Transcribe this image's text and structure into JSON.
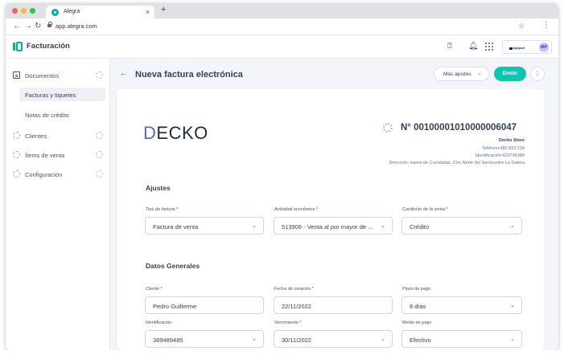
{
  "browser": {
    "tab_title": "Alegra",
    "tab_close": "×",
    "new_tab": "+",
    "url": "app.alegra.com",
    "dot_colors": [
      "#ff5f57",
      "#febc2e",
      "#28c840"
    ]
  },
  "header": {
    "app_title": "Facturación",
    "company_logo": "topsport",
    "avatar": "MP"
  },
  "sidebar": {
    "documentos": "Documentos",
    "facturas": "Facturas y tiquetes",
    "notas": "Notas de crédito",
    "clientes": "Clientes",
    "items": "Ítems de venta",
    "configuracion": "Configuración"
  },
  "page": {
    "title": "Nueva factura electrónica",
    "mas_ajustes": "Más ajustes",
    "emitir": "Emitir"
  },
  "invoice": {
    "brand_initial": "D",
    "brand_rest": "ECKO",
    "number": "N° 00100001010000006047",
    "company_name": "Decko Store",
    "telefono": "Teléfono:980 833 234",
    "identificacion": "Identificación:429745384",
    "direccion": "Dirección: inares de Curridabat, 21m Norte del Servicentro La Galera"
  },
  "ajustes": {
    "title": "Ajustes",
    "tipo_label": "Tipo de factura *",
    "tipo_value": "Factura de venta",
    "actividad_label": "Actividad económica *",
    "actividad_value": "513906 - Venta al por mayor de ...",
    "condicion_label": "Condición de la venta *",
    "condicion_value": "Crédito"
  },
  "datos": {
    "title": "Datos Generales",
    "cliente_label": "Cliente *",
    "cliente_value": "Pedro Guillerme",
    "fecha_label": "Fecha de creación *",
    "fecha_value": "22/11/2022",
    "plazo_label": "Plazo de pago",
    "plazo_value": "8 días",
    "identificacion_label": "Identificación",
    "identificacion_value": "389489485",
    "vencimiento_label": "Vencimiento *",
    "vencimiento_value": "30/11/2022",
    "medio_label": "Medio de pago",
    "medio_value": "Efectivo"
  },
  "colors": {
    "accent": "#12c3b0",
    "brand_blue": "#4b6fb5"
  }
}
